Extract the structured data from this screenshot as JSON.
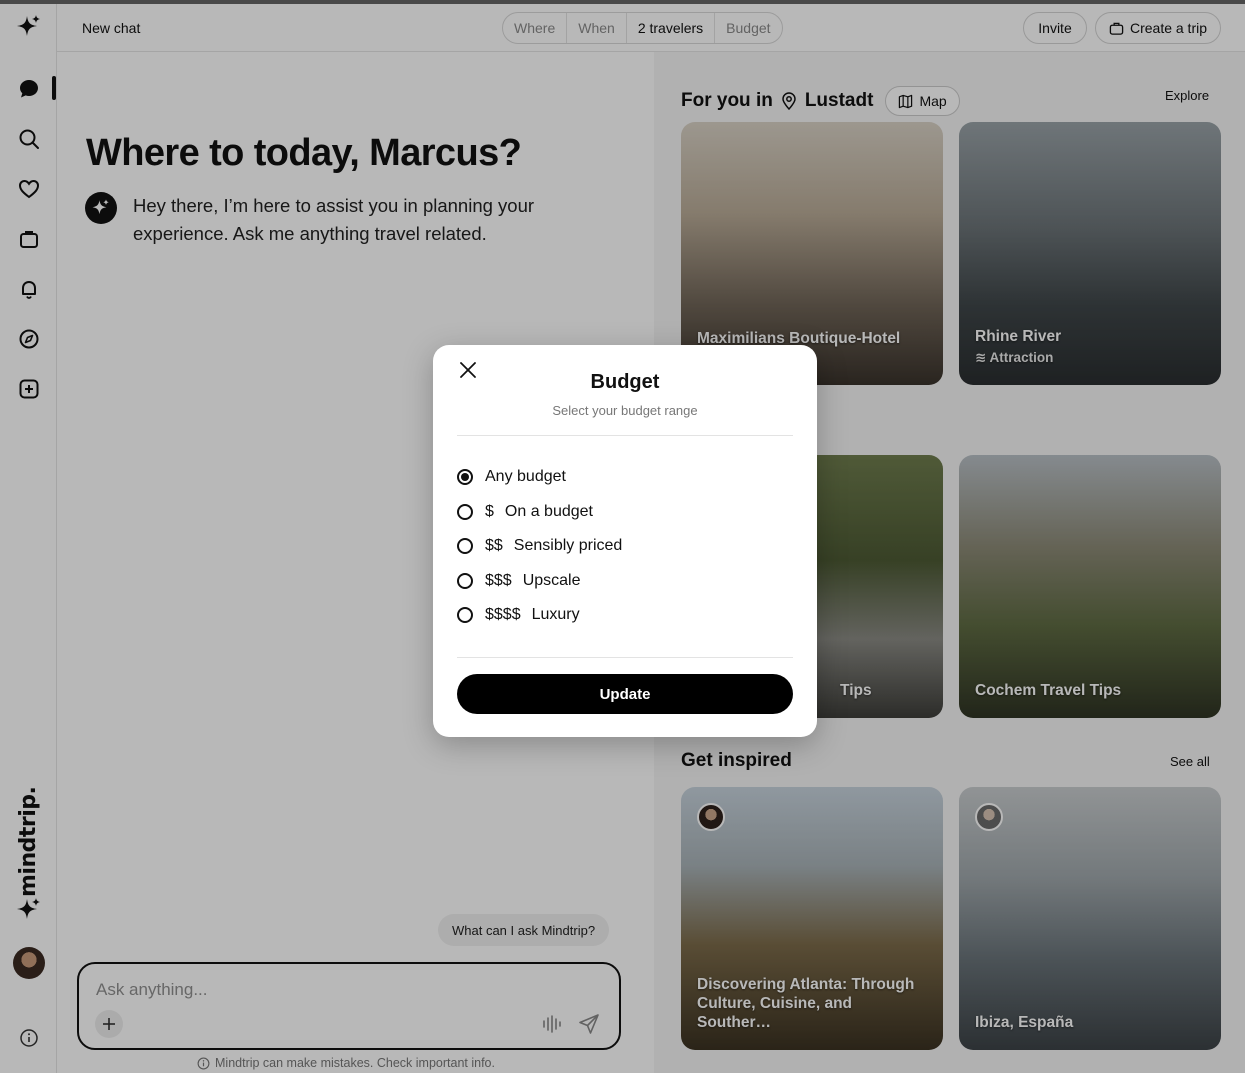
{
  "header": {
    "chat_title": "New chat",
    "filters": [
      "Where",
      "When",
      "2 travelers",
      "Budget"
    ],
    "invite_label": "Invite",
    "create_trip_label": "Create a trip"
  },
  "rail": {
    "brand": "mindtrip.",
    "icons": [
      "sparkle-logo-icon",
      "chat-icon",
      "search-icon",
      "heart-icon",
      "suitcase-icon",
      "bell-icon",
      "compass-icon",
      "add-square-icon",
      "info-icon"
    ]
  },
  "chat": {
    "greeting": "Where to today, Marcus?",
    "bot_message": "Hey there, I’m here to assist you in planning your experience. Ask me anything travel related.",
    "suggestion": "What can I ask Mindtrip?",
    "input_placeholder": "Ask anything...",
    "disclaimer": "Mindtrip can make mistakes. Check important info."
  },
  "panel": {
    "for_you_prefix": "For you in",
    "location": "Lustadt",
    "map_label": "Map",
    "explore_label": "Explore",
    "cards": [
      {
        "title": "Maximilians Boutique-Hotel Landau",
        "subtitle": ""
      },
      {
        "title": "Rhine River",
        "subtitle": "≋ Attraction"
      },
      {
        "title": "Tips",
        "subtitle": ""
      },
      {
        "title": "Cochem Travel Tips",
        "subtitle": ""
      }
    ],
    "inspired_title": "Get inspired",
    "see_all_label": "See all",
    "inspired_cards": [
      {
        "title": "Discovering Atlanta: Through Culture, Cuisine, and Souther…"
      },
      {
        "title": "Ibiza, España"
      }
    ]
  },
  "modal": {
    "title": "Budget",
    "subtitle": "Select your budget range",
    "options": [
      {
        "symbol": "",
        "label": "Any budget",
        "selected": true
      },
      {
        "symbol": "$",
        "label": "On a budget",
        "selected": false
      },
      {
        "symbol": "$$",
        "label": "Sensibly priced",
        "selected": false
      },
      {
        "symbol": "$$$",
        "label": "Upscale",
        "selected": false
      },
      {
        "symbol": "$$$$",
        "label": "Luxury",
        "selected": false
      }
    ],
    "update_label": "Update"
  }
}
